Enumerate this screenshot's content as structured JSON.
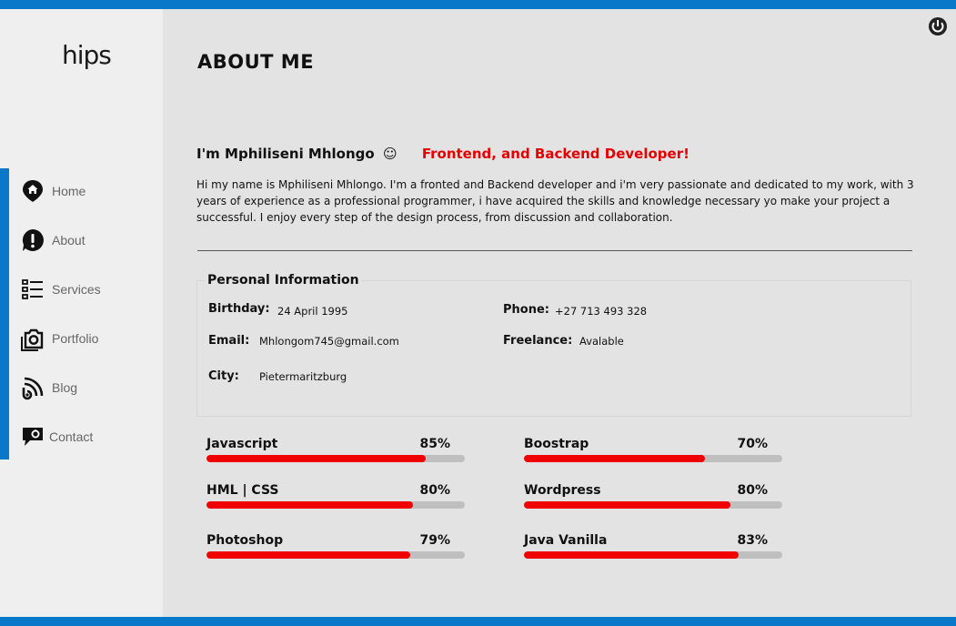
{
  "app": {
    "logo": "hips",
    "colors": {
      "accent": "#0a78c8",
      "highlight": "#e40000",
      "bar_fill": "#f00000",
      "bar_track": "#bfbfbf"
    }
  },
  "sidebar": {
    "items": [
      {
        "label": "Home",
        "icon": "home-pin-icon"
      },
      {
        "label": "About",
        "icon": "info-exclamation-icon"
      },
      {
        "label": "Services",
        "icon": "list-icon"
      },
      {
        "label": "Portfolio",
        "icon": "camera-icon"
      },
      {
        "label": "Blog",
        "icon": "blog-feed-icon"
      },
      {
        "label": "Contact",
        "icon": "chat-bubble-icon"
      }
    ]
  },
  "header": {
    "power_icon": "power-icon"
  },
  "main": {
    "title": "ABOUT ME",
    "intro_name": "I'm Mphiliseni Mhlongo",
    "intro_emoji": "☺",
    "intro_role": "Frontend, and Backend Developer!",
    "bio": "Hi my name is Mphiliseni Mhlongo. I'm a fronted and Backend developer and i'm very passionate and dedicated to my work, with 3  years of experience as a professional programmer, i have acquired the skills and knowledge necessary yo make your project a successful. I enjoy every step of the design process, from discussion and collaboration.",
    "personal_info": {
      "title": "Personal Information",
      "birthday_label": "Birthday:",
      "birthday": "24 April 1995",
      "phone_label": "Phone:",
      "phone": "+27 713 493 328",
      "email_label": "Email:",
      "email": "Mhlongom745@gmail.com",
      "freelance_label": "Freelance:",
      "freelance": "Avalable",
      "city_label": "City:",
      "city": "Pietermaritzburg"
    },
    "skills": [
      {
        "name": "Javascript",
        "percent_label": "85%",
        "value": 85
      },
      {
        "name": "Boostrap",
        "percent_label": "70%",
        "value": 70
      },
      {
        "name": "HML | CSS",
        "percent_label": "80%",
        "value": 80
      },
      {
        "name": "Wordpress",
        "percent_label": "80%",
        "value": 80
      },
      {
        "name": "Photoshop",
        "percent_label": "79%",
        "value": 79
      },
      {
        "name": "Java Vanilla",
        "percent_label": "83%",
        "value": 83
      }
    ]
  }
}
